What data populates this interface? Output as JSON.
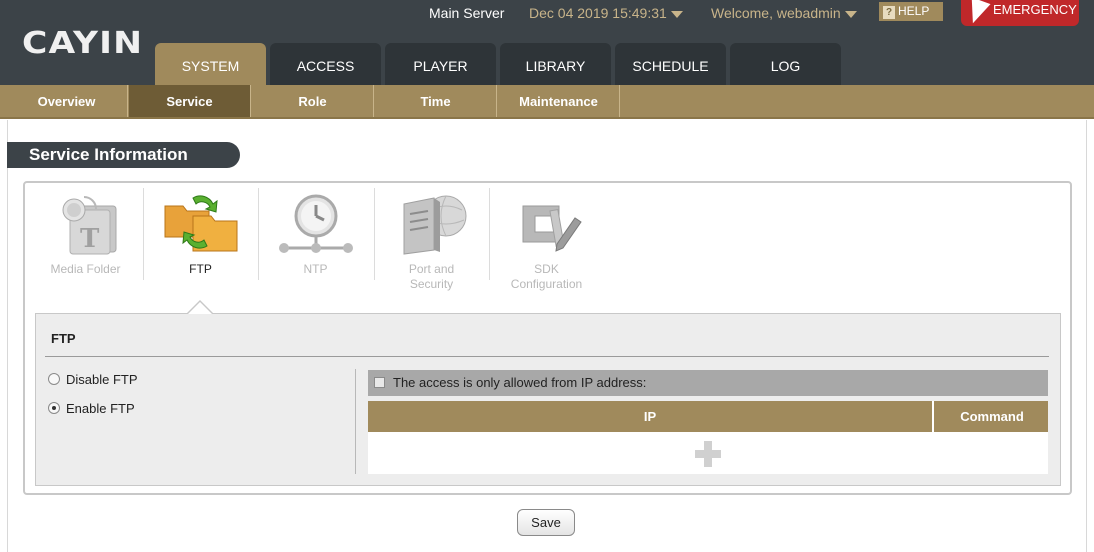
{
  "header": {
    "logo": "CAYIN",
    "server_name": "Main Server",
    "datetime": "Dec 04 2019 15:49:31",
    "welcome": "Welcome, webadmin",
    "help_label": "HELP",
    "emergency_label": "EMERGENCY"
  },
  "main_tabs": [
    "SYSTEM",
    "ACCESS",
    "PLAYER",
    "LIBRARY",
    "SCHEDULE",
    "LOG"
  ],
  "active_main_tab": "SYSTEM",
  "sub_tabs": [
    "Overview",
    "Service",
    "Role",
    "Time",
    "Maintenance"
  ],
  "active_sub_tab": "Service",
  "section_title": "Service Information",
  "services": [
    {
      "label": "Media Folder",
      "icon": "media-folder-icon"
    },
    {
      "label": "FTP",
      "icon": "ftp-folders-icon"
    },
    {
      "label": "NTP",
      "icon": "ntp-clock-icon"
    },
    {
      "label_line1": "Port and",
      "label_line2": "Security",
      "icon": "server-globe-icon"
    },
    {
      "label_line1": "SDK",
      "label_line2": "Configuration",
      "icon": "sdk-tools-icon"
    }
  ],
  "active_service": "FTP",
  "ftp": {
    "title": "FTP",
    "options": [
      {
        "label": "Disable FTP",
        "checked": false
      },
      {
        "label": "Enable FTP",
        "checked": true
      }
    ],
    "ip_restriction_label": "The access is only allowed from IP address:",
    "ip_restriction_checked": false,
    "table_headers": {
      "ip": "IP",
      "command": "Command"
    }
  },
  "save_label": "Save",
  "colors": {
    "header_bg": "#3c4348",
    "accent_gold": "#a08a5c",
    "emergency_red": "#c0282a"
  }
}
